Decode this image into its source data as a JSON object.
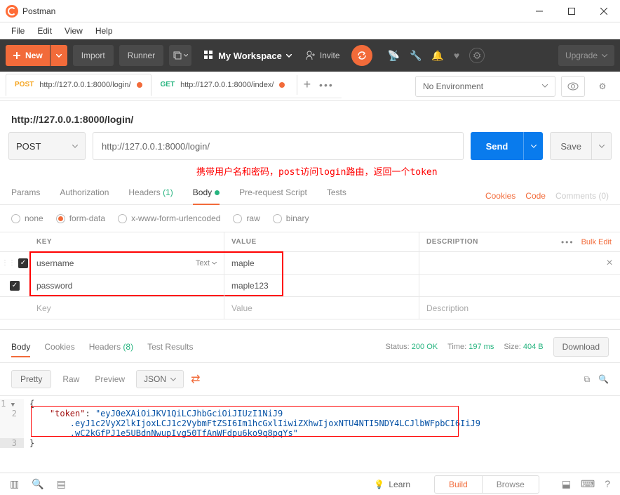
{
  "app": {
    "title": "Postman"
  },
  "menubar": {
    "file": "File",
    "edit": "Edit",
    "view": "View",
    "help": "Help"
  },
  "toolbar": {
    "new_label": "New",
    "import_label": "Import",
    "runner_label": "Runner",
    "workspace_label": "My Workspace",
    "invite_label": "Invite",
    "upgrade_label": "Upgrade"
  },
  "environment": {
    "selected": "No Environment"
  },
  "tabs": [
    {
      "method": "POST",
      "method_class": "method-post",
      "url": "http://127.0.0.1:8000/login/",
      "modified": true,
      "active": true
    },
    {
      "method": "GET",
      "method_class": "method-get",
      "url": "http://127.0.0.1:8000/index/",
      "modified": true,
      "active": false
    }
  ],
  "request": {
    "name": "http://127.0.0.1:8000/login/",
    "method": "POST",
    "url": "http://127.0.0.1:8000/login/",
    "send_label": "Send",
    "save_label": "Save",
    "annotation": "携带用户名和密码，post访问login路由，返回一个token"
  },
  "subtabs": {
    "params": "Params",
    "authorization": "Authorization",
    "headers": "Headers",
    "headers_count": "(1)",
    "body": "Body",
    "prerequest": "Pre-request Script",
    "tests": "Tests",
    "cookies": "Cookies",
    "code": "Code",
    "comments": "Comments (0)"
  },
  "body_types": {
    "none": "none",
    "formdata": "form-data",
    "urlencoded": "x-www-form-urlencoded",
    "raw": "raw",
    "binary": "binary",
    "selected": "form-data"
  },
  "kv_table": {
    "key_header": "KEY",
    "value_header": "VALUE",
    "desc_header": "DESCRIPTION",
    "bulk_edit": "Bulk Edit",
    "type_text": "Text",
    "rows": [
      {
        "key": "username",
        "value": "maple",
        "checked": true,
        "show_type": true,
        "show_delete": true
      },
      {
        "key": "password",
        "value": "maple123",
        "checked": true,
        "show_type": false,
        "show_delete": false
      }
    ],
    "placeholder_key": "Key",
    "placeholder_value": "Value",
    "placeholder_desc": "Description"
  },
  "response": {
    "tabs": {
      "body": "Body",
      "cookies": "Cookies",
      "headers": "Headers",
      "headers_count": "(8)",
      "test_results": "Test Results"
    },
    "status_label": "Status:",
    "status": "200 OK",
    "time_label": "Time:",
    "time": "197 ms",
    "size_label": "Size:",
    "size": "404 B",
    "download": "Download",
    "views": {
      "pretty": "Pretty",
      "raw": "Raw",
      "preview": "Preview",
      "format": "JSON"
    },
    "json": {
      "line1_open": "{",
      "line2_key": "\"token\"",
      "line2_val": "\"eyJ0eXAiOiJKV1QiLCJhbGciOiJIUzI1NiJ9\n        .eyJ1c2VyX2lkIjoxLCJ1c2VybmFtZSI6Im1hcGxlIiwiZXhwIjoxNTU4NTI5NDY4LCJlbWFpbCI6IiJ9\n        .wC2kGfPJ1e5UBdnNwupIvg50TfAnWFdpu6ko9q8pqYs\"",
      "line3_close": "}"
    }
  },
  "bottombar": {
    "learn": "Learn",
    "build": "Build",
    "browse": "Browse"
  }
}
